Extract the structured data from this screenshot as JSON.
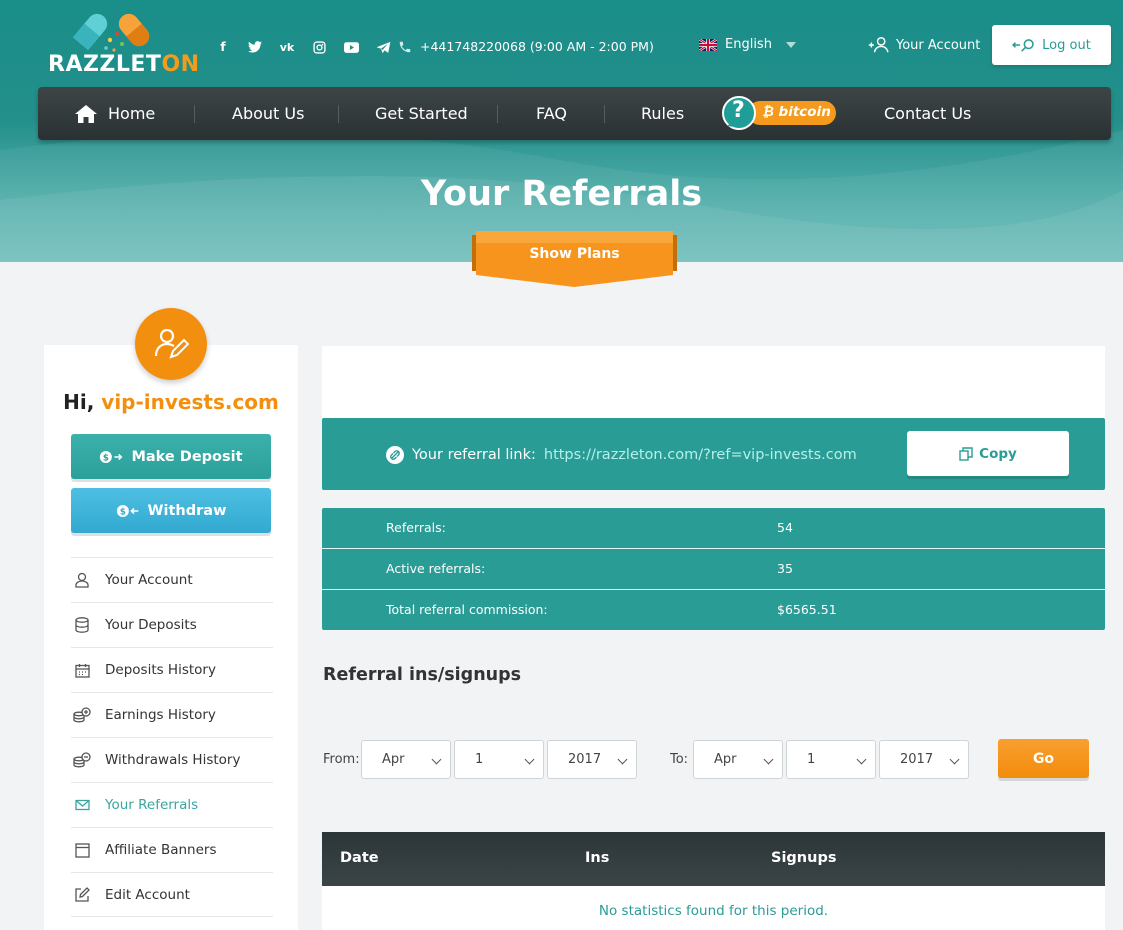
{
  "brand": {
    "name_part1": "RAZZLET",
    "name_part2": "ON"
  },
  "header": {
    "phone": "+441748220068 (9:00 AM - 2:00 PM)",
    "language": "English",
    "account_label": "Your Account",
    "logout_label": "Log out"
  },
  "nav": {
    "home": "Home",
    "about": "About Us",
    "get_started": "Get Started",
    "faq": "FAQ",
    "rules": "Rules",
    "bitcoin": "bitcoin",
    "contact": "Contact Us"
  },
  "page": {
    "title": "Your Referrals",
    "show_plans": "Show Plans"
  },
  "sidebar": {
    "greeting": "Hi,",
    "username": "vip-invests.com",
    "make_deposit": "Make Deposit",
    "withdraw": "Withdraw",
    "items": [
      {
        "label": "Your Account",
        "icon": "user-icon"
      },
      {
        "label": "Your Deposits",
        "icon": "database-icon"
      },
      {
        "label": "Deposits History",
        "icon": "calendar-icon"
      },
      {
        "label": "Earnings History",
        "icon": "coins-plus-icon"
      },
      {
        "label": "Withdrawals History",
        "icon": "coins-minus-icon"
      },
      {
        "label": "Your Referrals",
        "icon": "envelope-icon",
        "active": true
      },
      {
        "label": "Affiliate Banners",
        "icon": "window-icon"
      },
      {
        "label": "Edit Account",
        "icon": "edit-icon"
      }
    ]
  },
  "referral": {
    "label": "Your referral link:",
    "link": "https://razzleton.com/?ref=vip-invests.com",
    "copy": "Copy"
  },
  "stats": {
    "rows": [
      {
        "label": "Referrals:",
        "value": "54"
      },
      {
        "label": "Active referrals:",
        "value": "35"
      },
      {
        "label": "Total referral commission:",
        "value": "$6565.51"
      }
    ]
  },
  "signups": {
    "title": "Referral ins/signups",
    "from_label": "From:",
    "to_label": "To:",
    "from": {
      "month": "Apr",
      "day": "1",
      "year": "2017"
    },
    "to": {
      "month": "Apr",
      "day": "1",
      "year": "2017"
    },
    "go": "Go",
    "columns": [
      "Date",
      "Ins",
      "Signups"
    ],
    "empty": "No statistics found for this period."
  },
  "colors": {
    "teal": "#2a9c96",
    "orange": "#f38f0f",
    "dark": "#2c3537"
  }
}
